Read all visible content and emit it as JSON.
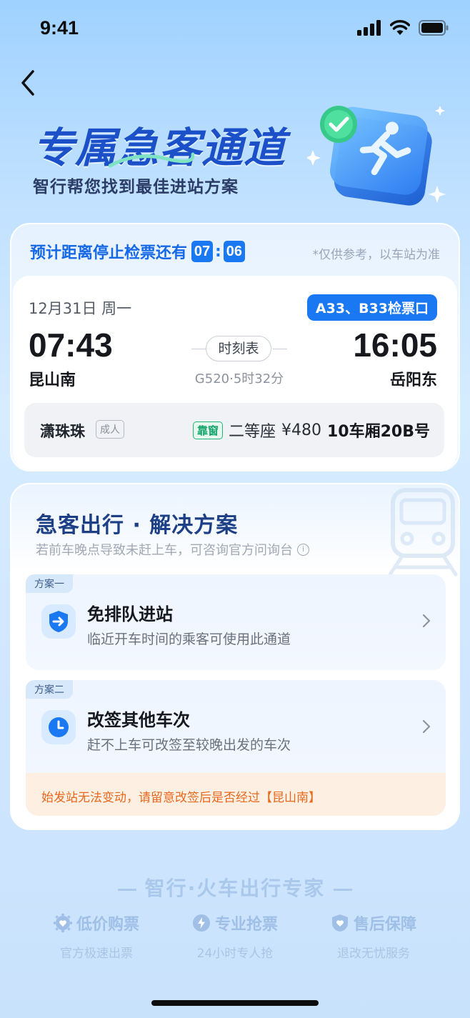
{
  "status_bar": {
    "time": "9:41"
  },
  "hero": {
    "title": "专属急客通道",
    "subtitle": "智行帮您找到最佳进站方案"
  },
  "countdown": {
    "label": "预计距离停止检票还有",
    "minutes": "07",
    "separator": ":",
    "seconds": "06",
    "note": "*仅供参考，以车站为准"
  },
  "ticket": {
    "date": "12月31日 周一",
    "gate": "A33、B33检票口",
    "departure_time": "07:43",
    "departure_station": "昆山南",
    "arrival_time": "16:05",
    "arrival_station": "岳阳东",
    "schedule_label": "时刻表",
    "train_info": "G520·5时32分",
    "passenger": {
      "name": "潇珠珠",
      "type": "成人",
      "window_tag": "靠窗",
      "seat_class": "二等座",
      "price": "¥480",
      "seat": "10车厢20B号"
    }
  },
  "solutions": {
    "title": "急客出行 · 解决方案",
    "subtitle": "若前车晚点导致未赶上车，可咨询官方问询台",
    "plans": [
      {
        "tag": "方案一",
        "title": "免排队进站",
        "desc": "临近开车时间的乘客可使用此通道",
        "icon": "arrow-right-shield-icon"
      },
      {
        "tag": "方案二",
        "title": "改签其他车次",
        "desc": "赶不上车可改签至较晚出发的车次",
        "icon": "clock-icon",
        "warning": "始发站无法变动，请留意改签后是否经过【昆山南】"
      }
    ]
  },
  "footer": {
    "brand": "智行·火车出行专家",
    "features": [
      {
        "title": "低价购票",
        "desc": "官方极速出票",
        "icon": "gear-heart-icon"
      },
      {
        "title": "专业抢票",
        "desc": "24小时专人抢",
        "icon": "bolt-icon"
      },
      {
        "title": "售后保障",
        "desc": "退改无忧服务",
        "icon": "shield-heart-icon"
      }
    ]
  },
  "colors": {
    "accent_blue": "#1a78f2",
    "title_blue": "#1c50c8",
    "window_green": "#13a46b",
    "warning_orange": "#e8681e"
  }
}
